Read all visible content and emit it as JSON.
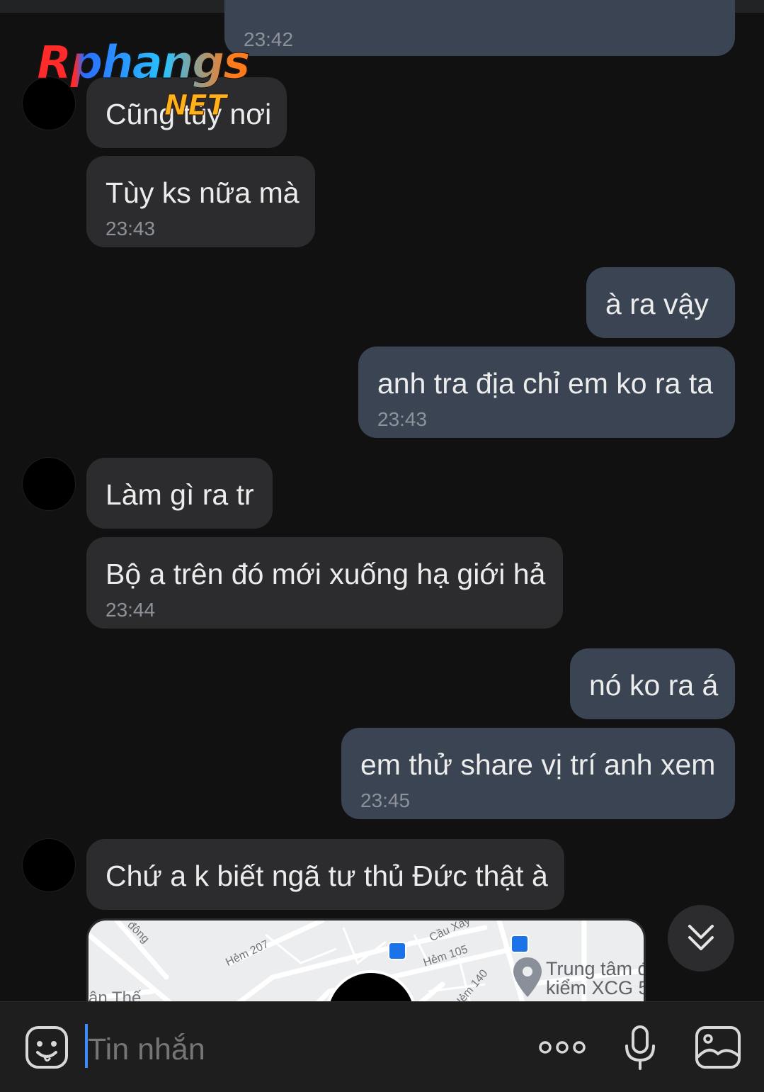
{
  "logo": {
    "main": "Rphangs",
    "sub": "NET"
  },
  "messages": [
    {
      "side": "out",
      "text": "",
      "time": "23:42"
    },
    {
      "side": "in",
      "text": "Cũng tùy nơi",
      "time": ""
    },
    {
      "side": "in",
      "text": "Tùy ks nữa mà",
      "time": "23:43"
    },
    {
      "side": "out",
      "text": "à ra vậy",
      "time": ""
    },
    {
      "side": "out",
      "text": "anh tra địa chỉ em ko ra ta",
      "time": "23:43"
    },
    {
      "side": "in",
      "text": "Làm gì ra tr",
      "time": ""
    },
    {
      "side": "in",
      "text": "Bộ a trên đó mới xuống hạ giới hả",
      "time": "23:44"
    },
    {
      "side": "out",
      "text": "nó ko ra á",
      "time": ""
    },
    {
      "side": "out",
      "text": "em thử share vị trí anh xem",
      "time": "23:45"
    },
    {
      "side": "in",
      "text": "Chứ a k biết ngã tư thủ Đức thật à",
      "time": ""
    }
  ],
  "map": {
    "labels": [
      "đông",
      "Hẻm 207",
      "Cầu Xáy",
      "Hẻm 105",
      "Hẻm 140",
      "ận Thế"
    ],
    "place": [
      "Trung tâm đ",
      "kiểm XCG 5"
    ]
  },
  "composer": {
    "placeholder": "Tin nhắn"
  },
  "icons": {
    "sticker": "sticker-icon",
    "more": "more-icon",
    "mic": "microphone-icon",
    "image": "image-icon",
    "scroll_down": "double-chevron-down-icon"
  }
}
